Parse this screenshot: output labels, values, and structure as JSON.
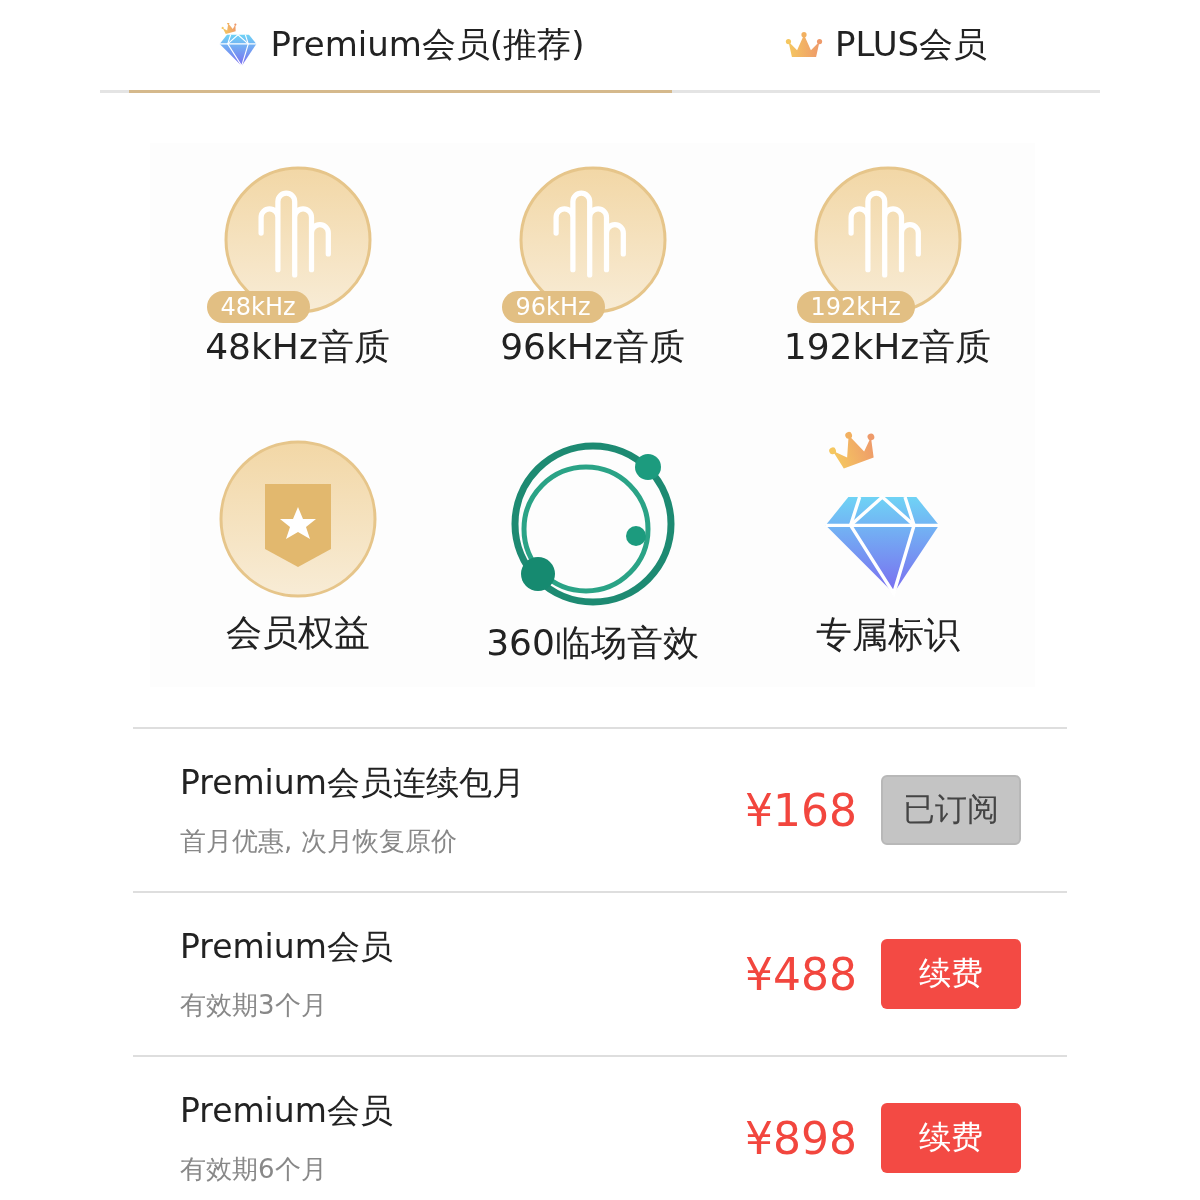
{
  "tabs": [
    {
      "label": "Premium会员(推荐)",
      "kind": "premium",
      "selected": true
    },
    {
      "label": "PLUS会员",
      "kind": "plus",
      "selected": false
    }
  ],
  "features": [
    {
      "kind": "wave",
      "badge": "48kHz",
      "label": "48kHz音质"
    },
    {
      "kind": "wave",
      "badge": "96kHz",
      "label": "96kHz音质"
    },
    {
      "kind": "wave",
      "badge": "192kHz",
      "label": "192kHz音质"
    },
    {
      "kind": "shield",
      "label": "会员权益"
    },
    {
      "kind": "orbit",
      "label": "360临场音效"
    },
    {
      "kind": "diamond",
      "label": "专属标识"
    }
  ],
  "plans": [
    {
      "title": "Premium会员连续包月",
      "subtitle": "首月优惠, 次月恢复原价",
      "price": "¥168",
      "button": "已订阅",
      "disabled": true
    },
    {
      "title": "Premium会员",
      "subtitle": "有效期3个月",
      "price": "¥488",
      "button": "续费",
      "disabled": false
    },
    {
      "title": "Premium会员",
      "subtitle": "有效期6个月",
      "price": "¥898",
      "button": "续费",
      "disabled": false
    }
  ]
}
